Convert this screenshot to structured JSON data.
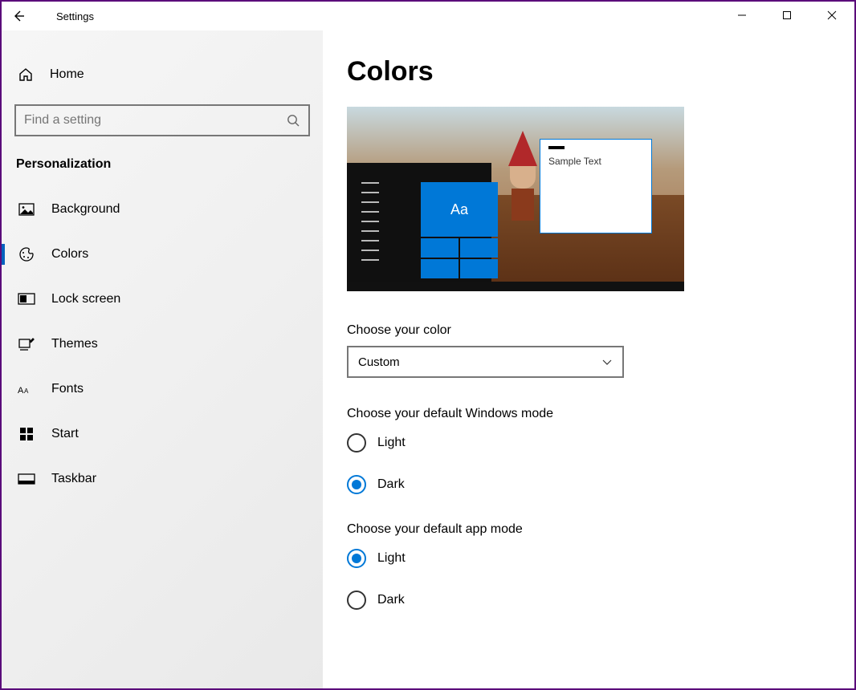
{
  "window": {
    "title": "Settings"
  },
  "sidebar": {
    "home_label": "Home",
    "search_placeholder": "Find a setting",
    "section_title": "Personalization",
    "items": [
      {
        "label": "Background",
        "icon": "image-icon",
        "selected": false
      },
      {
        "label": "Colors",
        "icon": "palette-icon",
        "selected": true
      },
      {
        "label": "Lock screen",
        "icon": "lockscreen-icon",
        "selected": false
      },
      {
        "label": "Themes",
        "icon": "themes-icon",
        "selected": false
      },
      {
        "label": "Fonts",
        "icon": "fonts-icon",
        "selected": false
      },
      {
        "label": "Start",
        "icon": "start-icon",
        "selected": false
      },
      {
        "label": "Taskbar",
        "icon": "taskbar-icon",
        "selected": false
      }
    ]
  },
  "main": {
    "page_title": "Colors",
    "preview": {
      "tile_text": "Aa",
      "sample_text": "Sample Text"
    },
    "choose_color": {
      "label": "Choose your color",
      "selected": "Custom"
    },
    "windows_mode": {
      "label": "Choose your default Windows mode",
      "options": [
        {
          "label": "Light",
          "checked": false
        },
        {
          "label": "Dark",
          "checked": true
        }
      ]
    },
    "app_mode": {
      "label": "Choose your default app mode",
      "options": [
        {
          "label": "Light",
          "checked": true
        },
        {
          "label": "Dark",
          "checked": false
        }
      ]
    }
  }
}
